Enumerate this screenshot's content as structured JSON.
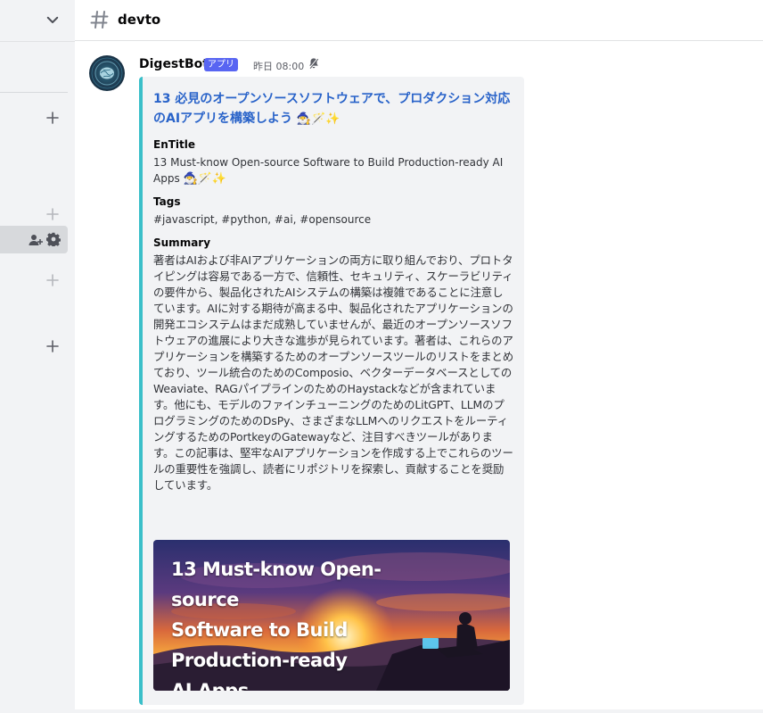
{
  "channel": {
    "name": "devto"
  },
  "message": {
    "author": "DigestBot",
    "badge": "アプリ",
    "timestamp": "昨日 08:00",
    "embed": {
      "title": "13 必見のオープンソースソフトウェアで、プロダクション対応のAIアプリを構築しよう",
      "title_emoji": "🧙‍♂️🪄✨",
      "fields": [
        {
          "name": "EnTitle",
          "value": "13 Must-know Open-source Software to Build Production-ready AI Apps",
          "emoji": "🧙‍♂️🪄✨"
        },
        {
          "name": "Tags",
          "value": "#javascript, #python, #ai, #opensource"
        },
        {
          "name": "Summary",
          "value": "著者はAIおよび非AIアプリケーションの両方に取り組んでおり、プロトタイピングは容易である一方で、信頼性、セキュリティ、スケーラビリティの要件から、製品化されたAIシステムの構築は複雑であることに注意しています。AIに対する期待が高まる中、製品化されたアプリケーションの開発エコシステムはまだ成熟していませんが、最近のオープンソースソフトウェアの進展により大きな進歩が見られています。著者は、これらのアプリケーションを構築するためのオープンソースツールのリストをまとめており、ツール統合のためのComposio、ベクターデータベースとしてのWeaviate、RAGパイプラインのためのHaystackなどが含まれています。他にも、モデルのファインチューニングのためのLitGPT、LLMのプログラミングのためのDsPy、さまざまなLLMへのリクエストをルーティングするためのPortkeyのGatewayなど、注目すべきツールがあります。この記事は、堅牢なAIアプリケーションを作成する上でこれらのツールの重要性を強調し、読者にリポジトリを探索し、貢献することを奨励しています。"
        }
      ],
      "image": {
        "lines": [
          "13 Must-know Open-source",
          "Software to Build",
          "Production-ready",
          "AI Apps"
        ]
      }
    }
  }
}
